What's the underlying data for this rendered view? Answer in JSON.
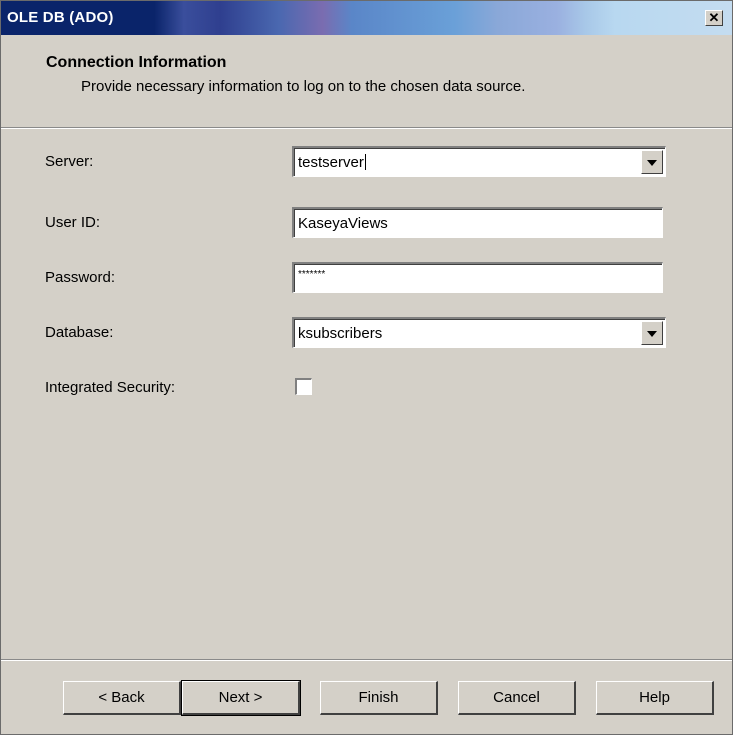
{
  "window": {
    "title": "OLE DB (ADO)",
    "close_glyph": "✕"
  },
  "header": {
    "title": "Connection Information",
    "subtitle": "Provide necessary information to log on to the chosen data source."
  },
  "form": {
    "server": {
      "label": "Server:",
      "value": "testserver"
    },
    "user_id": {
      "label": "User ID:",
      "value": "KaseyaViews"
    },
    "password": {
      "label": "Password:",
      "value": "*******"
    },
    "database": {
      "label": "Database:",
      "value": "ksubscribers"
    },
    "integrated_security": {
      "label": "Integrated Security:",
      "checked": false
    }
  },
  "buttons": {
    "back": "< Back",
    "next": "Next >",
    "finish": "Finish",
    "cancel": "Cancel",
    "help": "Help"
  }
}
